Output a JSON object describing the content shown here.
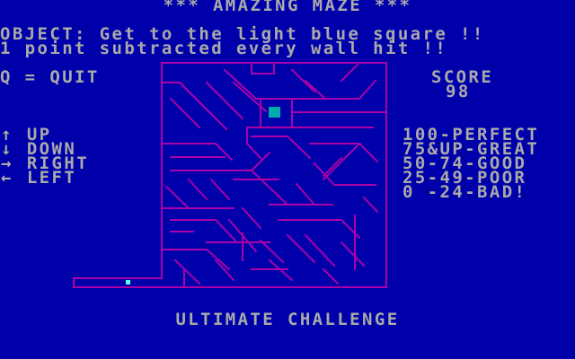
{
  "title": "*** AMAZING MAZE ***",
  "objective_line1": "OBJECT: Get to the light blue square !!",
  "objective_line2": "1 point subtracted every wall hit !!",
  "quit_hint": "Q = QUIT",
  "score": {
    "label": "SCORE",
    "value": "98"
  },
  "controls": [
    {
      "icon": "arrow-up-icon",
      "glyph": "↑",
      "label": "UP"
    },
    {
      "icon": "arrow-down-icon",
      "glyph": "↓",
      "label": "DOWN"
    },
    {
      "icon": "arrow-right-icon",
      "glyph": "→",
      "label": "RIGHT"
    },
    {
      "icon": "arrow-left-icon",
      "glyph": "←",
      "label": "LEFT"
    }
  ],
  "ratings": [
    "100-PERFECT",
    "75&UP-GREAT",
    "50-74-GOOD",
    "25-49-POOR",
    "0 -24-BAD!"
  ],
  "footer": "ULTIMATE CHALLENGE",
  "colors": {
    "background": "#0000aa",
    "text": "#aaaaaa",
    "maze_walls": "#aa00aa",
    "goal": "#00aaaa",
    "player": "#55ffff"
  }
}
